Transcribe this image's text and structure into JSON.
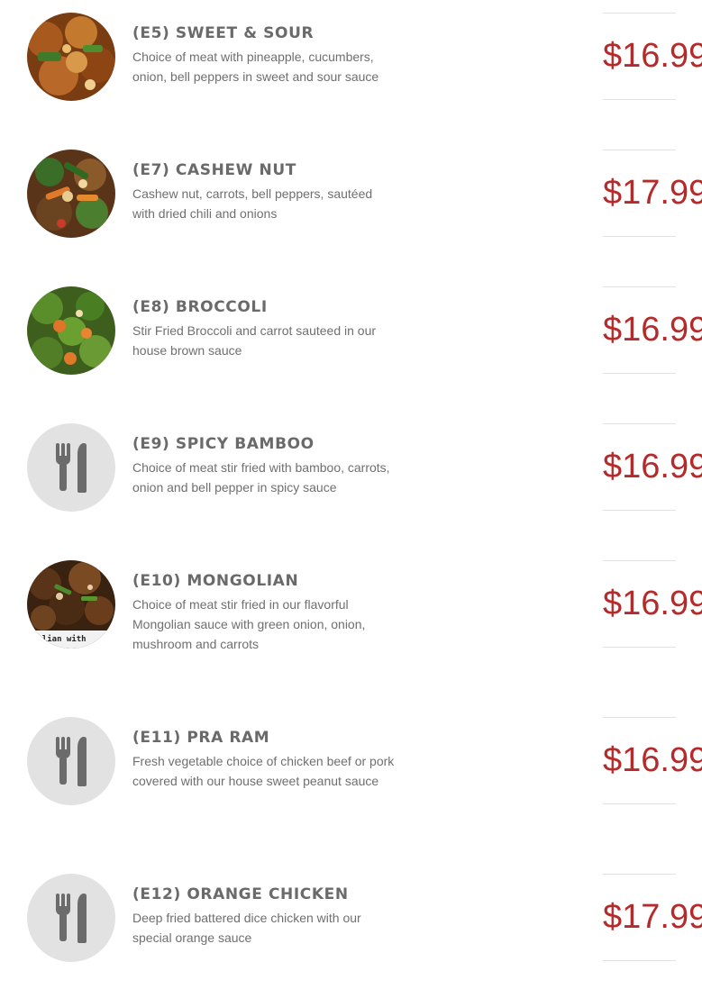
{
  "menu": {
    "items": [
      {
        "name": "(E5) SWEET & SOUR",
        "description": "Choice of meat with pineapple, cucumbers, onion, bell peppers in sweet and sour sauce",
        "price": "$16.99",
        "image": "photo"
      },
      {
        "name": "(E7) CASHEW NUT",
        "description": "Cashew nut, carrots, bell peppers, sautéed with dried chili and onions",
        "price": "$17.99",
        "image": "photo"
      },
      {
        "name": "(E8) BROCCOLI",
        "description": "Stir Fried Broccoli and carrot sauteed in our house brown sauce",
        "price": "$16.99",
        "image": "photo"
      },
      {
        "name": "(E9) SPICY BAMBOO",
        "description": "Choice of meat stir fried with bamboo, carrots, onion and bell pepper in spicy sauce",
        "price": "$16.99",
        "image": "fork-knife-icon"
      },
      {
        "name": "(E10) MONGOLIAN",
        "description": "Choice of meat stir fried in our flavorful Mongolian sauce with green onion, onion, mushroom and carrots",
        "price": "$16.99",
        "image": "photo",
        "image_caption": "golian with"
      },
      {
        "name": "(E11) PRA RAM",
        "description": "Fresh vegetable choice of chicken beef or pork covered with our house sweet peanut sauce",
        "price": "$16.99",
        "image": "fork-knife-icon"
      },
      {
        "name": "(E12) ORANGE CHICKEN",
        "description": "Deep fried battered dice chicken with our special orange sauce",
        "price": "$17.99",
        "image": "fork-knife-icon"
      }
    ]
  },
  "colors": {
    "price": "#b52a2a",
    "title": "#6a6a6a",
    "description": "#6f6f6f",
    "placeholder": "#e2e2e2",
    "icon": "#6b6b6b",
    "rule": "#e2e2e2"
  }
}
